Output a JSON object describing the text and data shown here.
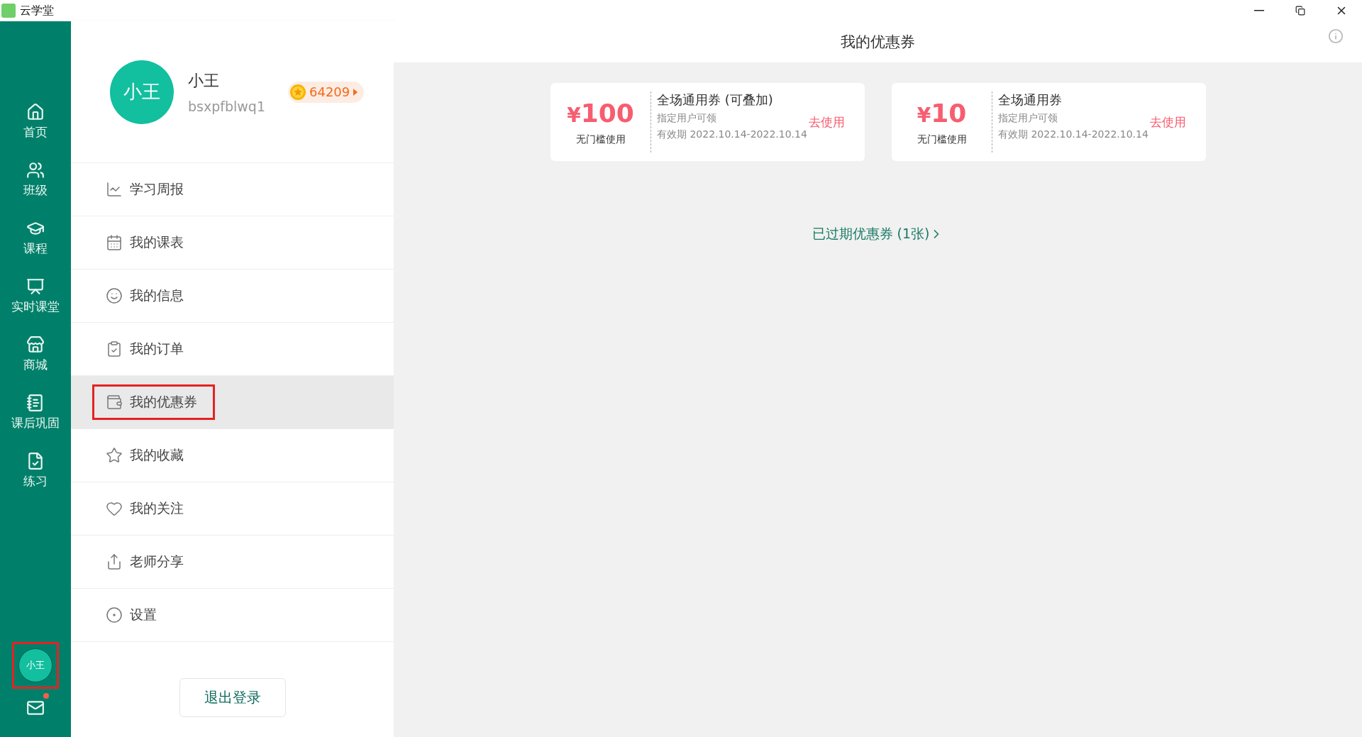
{
  "window": {
    "title": "云学堂"
  },
  "nav": [
    {
      "label": "首页"
    },
    {
      "label": "班级"
    },
    {
      "label": "课程"
    },
    {
      "label": "实时课堂"
    },
    {
      "label": "商城"
    },
    {
      "label": "课后巩固"
    },
    {
      "label": "练习"
    }
  ],
  "nav_user": {
    "avatar": "小王",
    "highlighted": true
  },
  "mail": {
    "unread": true
  },
  "profile": {
    "avatar": "小王",
    "name": "小王",
    "username": "bsxpfblwq1",
    "points": "64209"
  },
  "menu": [
    {
      "label": "学习周报",
      "selected": false,
      "highlighted": false
    },
    {
      "label": "我的课表",
      "selected": false,
      "highlighted": false
    },
    {
      "label": "我的信息",
      "selected": false,
      "highlighted": false
    },
    {
      "label": "我的订单",
      "selected": false,
      "highlighted": false
    },
    {
      "label": "我的优惠券",
      "selected": true,
      "highlighted": true
    },
    {
      "label": "我的收藏",
      "selected": false,
      "highlighted": false
    },
    {
      "label": "我的关注",
      "selected": false,
      "highlighted": false
    },
    {
      "label": "老师分享",
      "selected": false,
      "highlighted": false
    },
    {
      "label": "设置",
      "selected": false,
      "highlighted": false
    }
  ],
  "logout": "退出登录",
  "page_title": "我的优惠券",
  "coupons": [
    {
      "currency": "¥",
      "amount": "100",
      "condition": "无门槛使用",
      "title": "全场通用券 (可叠加)",
      "audience": "指定用户可领",
      "validity": "有效期 2022.10.14-2022.10.14",
      "action": "去使用"
    },
    {
      "currency": "¥",
      "amount": "10",
      "condition": "无门槛使用",
      "title": "全场通用券",
      "audience": "指定用户可领",
      "validity": "有效期 2022.10.14-2022.10.14",
      "action": "去使用"
    }
  ],
  "expired_link": "已过期优惠券 (1张)"
}
